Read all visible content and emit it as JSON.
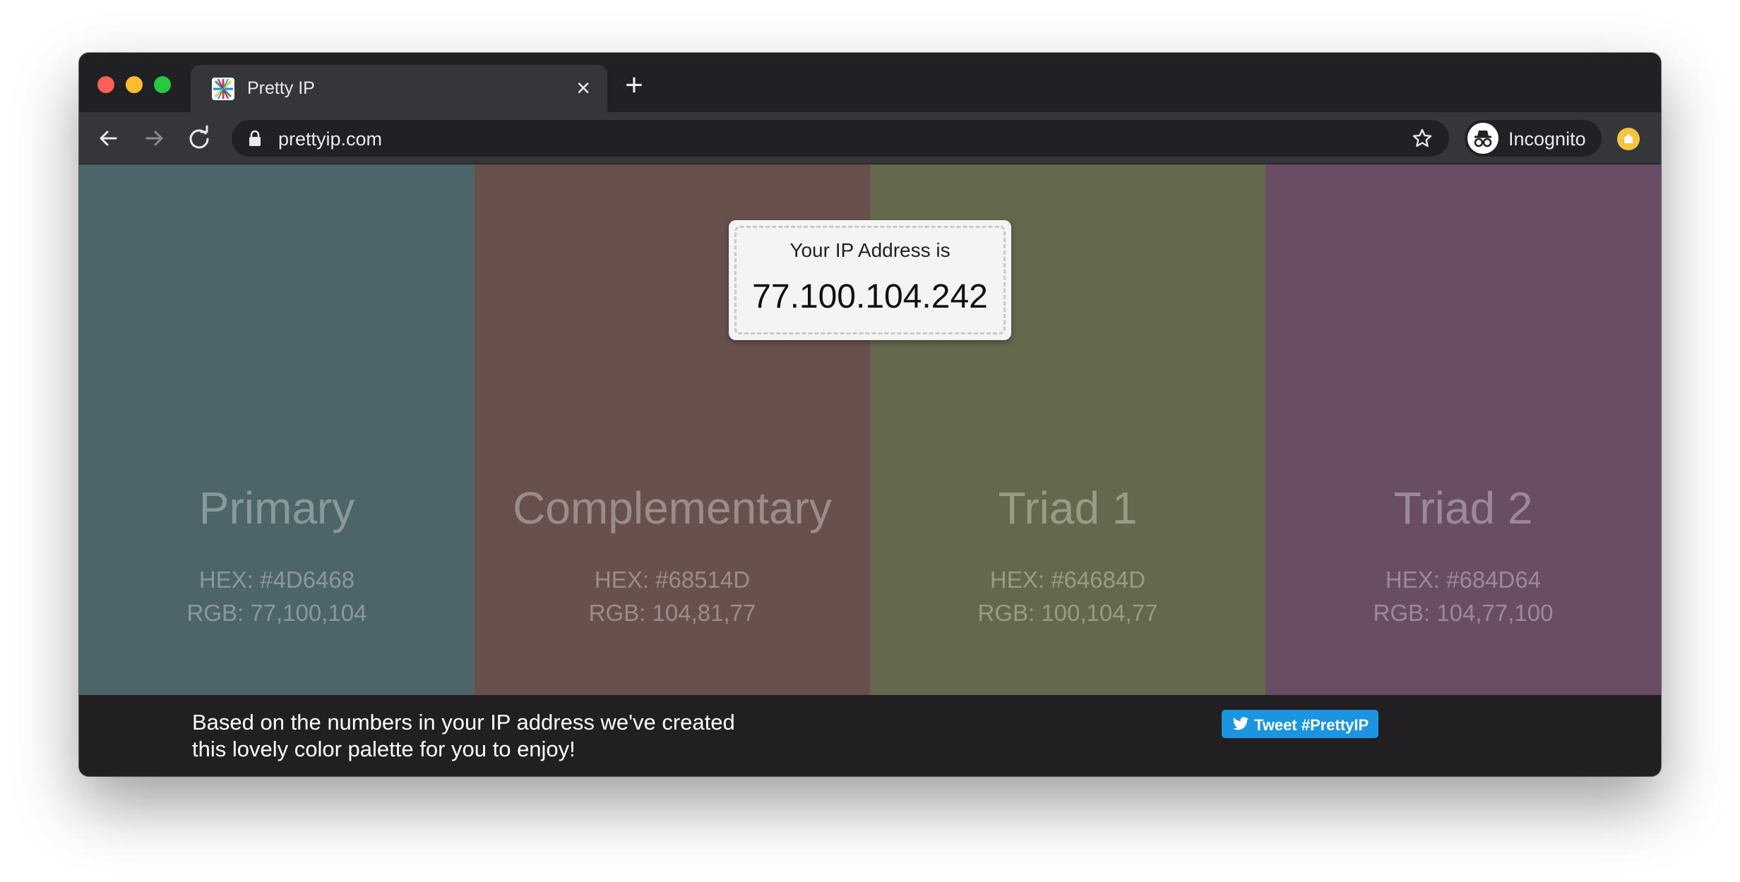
{
  "browser": {
    "tab_title": "Pretty IP",
    "tab_close_glyph": "×",
    "new_tab_glyph": "+",
    "url": "prettyip.com",
    "profile_label": "Incognito",
    "icons": {
      "favicon": "prettyip-favicon-icon",
      "back": "back-arrow-icon",
      "forward": "forward-arrow-icon",
      "reload": "reload-icon",
      "lock": "lock-icon",
      "bookmark": "star-icon",
      "incognito": "incognito-icon",
      "extension": "extension-icon"
    },
    "colors": {
      "frame": "#202124",
      "toolbar": "#35363a",
      "text": "#e8eaed"
    }
  },
  "ip_card": {
    "caption": "Your IP Address is",
    "value": "77.100.104.242"
  },
  "palette": [
    {
      "name": "Primary",
      "hex_label": "HEX: #4D6468",
      "rgb_label": "RGB: 77,100,104",
      "color": "#4D6468"
    },
    {
      "name": "Complementary",
      "hex_label": "HEX: #68514D",
      "rgb_label": "RGB: 104,81,77",
      "color": "#68514D"
    },
    {
      "name": "Triad 1",
      "hex_label": "HEX: #64684D",
      "rgb_label": "RGB: 100,104,77",
      "color": "#64684D"
    },
    {
      "name": "Triad 2",
      "hex_label": "HEX: #684D64",
      "rgb_label": "RGB: 104,77,100",
      "color": "#684D64"
    }
  ],
  "footer": {
    "line1": "Based on the numbers in your IP address we've created",
    "line2": "this lovely color palette for you to enjoy!",
    "tweet_label": "Tweet #PrettyIP",
    "tweet_color": "#1b95e0",
    "background": "#211f21"
  }
}
